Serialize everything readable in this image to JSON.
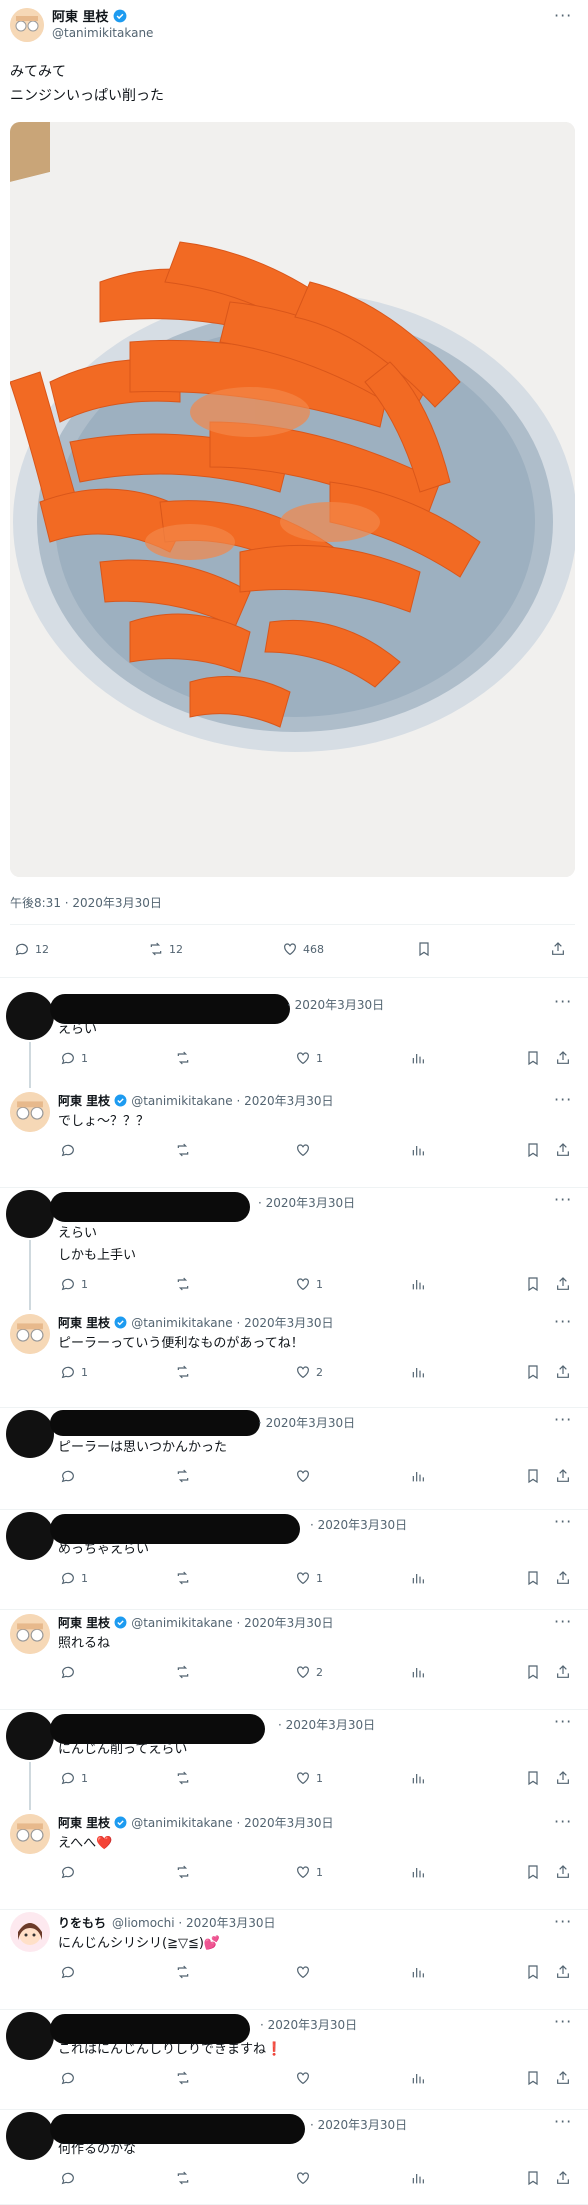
{
  "main_tweet": {
    "author_name": "阿東 里枝",
    "author_handle": "@tanimikitakane",
    "text_line1": "みてみて",
    "text_line2": "ニンジンいっぱい削った",
    "timestamp": "午後8:31 · 2020年3月30日",
    "replies": "12",
    "retweets": "12",
    "likes": "468",
    "more_label": "···"
  },
  "replies": [
    {
      "name": "",
      "handle": "",
      "date": "2020年3月30日",
      "text": "えらい",
      "text2": "",
      "reply_count": "1",
      "retweet_count": "",
      "like_count": "1",
      "avatar": "black"
    },
    {
      "name": "阿東 里枝",
      "handle": "@tanimikitakane",
      "date": "2020年3月30日",
      "text": "でしょ〜？？？",
      "text2": "",
      "reply_count": "",
      "retweet_count": "",
      "like_count": "",
      "avatar": "main"
    },
    {
      "name": "",
      "handle": "",
      "date": "2020年3月30日",
      "text": "えらい",
      "text2": "しかも上手い",
      "reply_count": "1",
      "retweet_count": "",
      "like_count": "1",
      "avatar": "black"
    },
    {
      "name": "阿東 里枝",
      "handle": "@tanimikitakane",
      "date": "2020年3月30日",
      "text": "ピーラーっていう便利なものがあってね！",
      "text2": "",
      "reply_count": "1",
      "retweet_count": "",
      "like_count": "2",
      "avatar": "main"
    },
    {
      "name": "",
      "handle": "",
      "date": "2020年3月30日",
      "text": "ピーラーは思いつかんかった",
      "text2": "",
      "reply_count": "",
      "retweet_count": "",
      "like_count": "",
      "avatar": "black"
    },
    {
      "name": "",
      "handle": "",
      "date": "2020年3月30日",
      "text": "めっちゃえらい",
      "text2": "",
      "reply_count": "1",
      "retweet_count": "",
      "like_count": "1",
      "avatar": "black"
    },
    {
      "name": "阿東 里枝",
      "handle": "@tanimikitakane",
      "date": "2020年3月30日",
      "text": "照れるね",
      "text2": "",
      "reply_count": "",
      "retweet_count": "",
      "like_count": "2",
      "avatar": "main"
    },
    {
      "name": "",
      "handle": "",
      "date": "2020年3月30日",
      "text": "にんじん削ってえらい",
      "text2": "",
      "reply_count": "1",
      "retweet_count": "",
      "like_count": "1",
      "avatar": "black"
    },
    {
      "name": "阿東 里枝",
      "handle": "@tanimikitakane",
      "date": "2020年3月30日",
      "text": "えへへ❤️",
      "text2": "",
      "reply_count": "",
      "retweet_count": "",
      "like_count": "1",
      "avatar": "main"
    },
    {
      "name": "りをもち",
      "handle": "@liomochi",
      "date": "2020年3月30日",
      "text": "にんじんシリシリ(≧▽≦)💕",
      "text2": "",
      "reply_count": "",
      "retweet_count": "",
      "like_count": "",
      "avatar": "girl"
    },
    {
      "name": "",
      "handle": "",
      "date": "2020年3月30日",
      "text": "これはにんじんしりしりできますね❗",
      "text2": "",
      "reply_count": "",
      "retweet_count": "",
      "like_count": "",
      "avatar": "black"
    },
    {
      "name": "",
      "handle": "",
      "date": "2020年3月30日",
      "text": "何作るのかな",
      "text2": "",
      "reply_count": "",
      "retweet_count": "",
      "like_count": "",
      "avatar": "black"
    }
  ],
  "icons": [
    "reply-icon",
    "retweet-icon",
    "like-icon",
    "views-icon",
    "bookmark-icon",
    "share-icon",
    "verified-icon",
    "more-icon"
  ],
  "colors": {
    "accent": "#1d9bf0",
    "carrot": "#f06a25",
    "plate": "#b9c7d4",
    "text_secondary": "#536471"
  }
}
